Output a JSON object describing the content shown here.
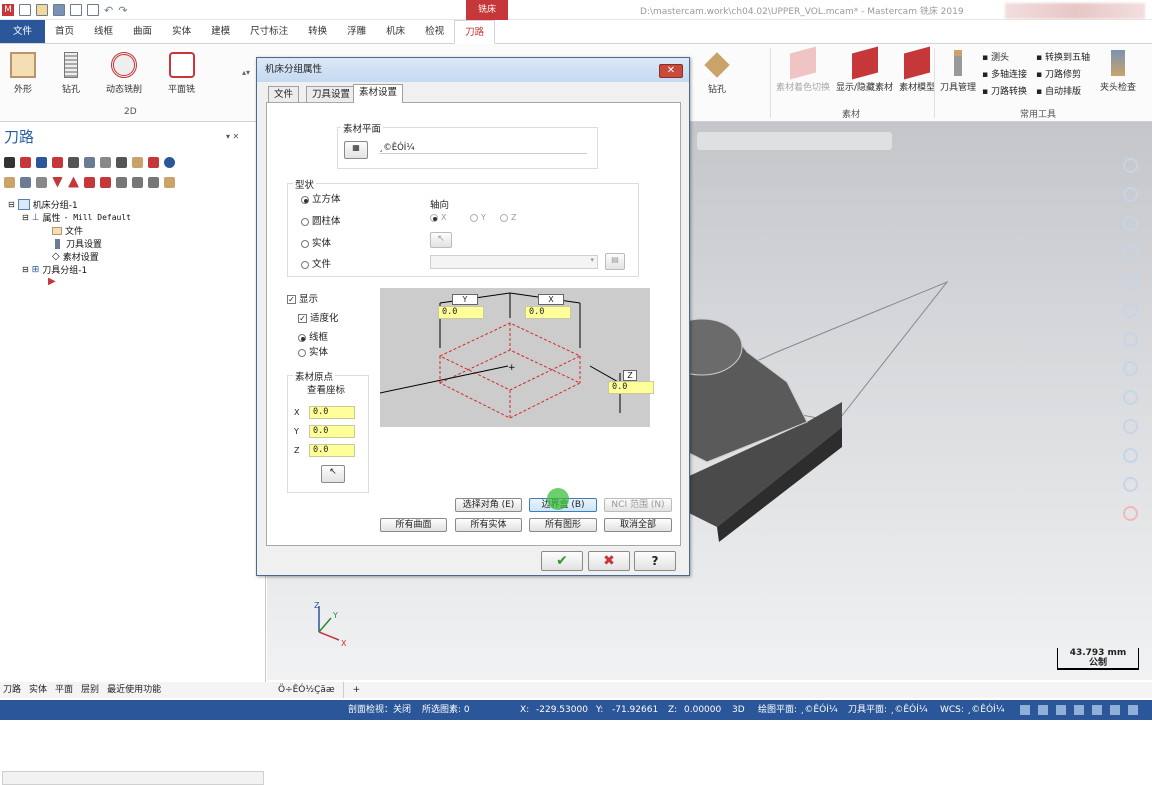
{
  "title_bar": {
    "context_tab": "铣床",
    "file_path": "D:\\mastercam.work\\ch04.02\\UPPER_VOL.mcam* - Mastercam 铣床 2019"
  },
  "menu": {
    "tabs": [
      "文件",
      "首页",
      "线框",
      "曲面",
      "实体",
      "建模",
      "尺寸标注",
      "转换",
      "浮雕",
      "机床",
      "检视",
      "刀路"
    ],
    "active": "刀路"
  },
  "ribbon": {
    "left_buttons": [
      "外形",
      "钻孔",
      "动态铣削",
      "平面铣"
    ],
    "left_group": "2D",
    "drill_button": "钻孔",
    "stock_buttons": [
      "素材着色切换",
      "显示/隐藏素材",
      "素材模型"
    ],
    "stock_group": "素材",
    "tool_manager": "刀具管理",
    "tool_small": [
      "测头",
      "多轴连接",
      "刀路转换",
      "转换到五轴",
      "刀路修剪",
      "自动排版"
    ],
    "clamp_check": "夹头检查",
    "common_group": "常用工具"
  },
  "left_panel": {
    "title": "刀路",
    "tree": [
      {
        "label": "机床分组-1"
      },
      {
        "label": "属性",
        "suffix": "- Mill Default"
      },
      {
        "label": "文件"
      },
      {
        "label": "刀具设置"
      },
      {
        "label": "素材设置"
      },
      {
        "label": "刀具分组-1"
      }
    ],
    "bottom_tabs": [
      "刀路",
      "实体",
      "平面",
      "层别",
      "最近使用功能"
    ]
  },
  "dialog": {
    "title": "机床分组属性",
    "tabs": [
      "文件",
      "刀具设置",
      "素材设置"
    ],
    "active_tab": "素材设置",
    "stock_plane": {
      "label": "素材平面",
      "value": "¸©ÊÓÍ¼"
    },
    "shape": {
      "label": "型状",
      "options": [
        "立方体",
        "圆柱体",
        "实体",
        "文件"
      ],
      "selected": "立方体"
    },
    "axis": {
      "label": "轴向",
      "options": [
        "X",
        "Y",
        "Z"
      ],
      "selected": "X"
    },
    "display": {
      "label": "显示",
      "checked": true
    },
    "fit": {
      "label": "适度化",
      "checked": true
    },
    "display_mode": {
      "options": [
        "线框",
        "实体"
      ],
      "selected": "线框"
    },
    "origin": {
      "label": "素材原点",
      "view_coords": "查看座标",
      "x": "0.0",
      "y": "0.0",
      "z": "0.0"
    },
    "dims": {
      "y_label": "Y",
      "y_value": "0.0",
      "x_label": "X",
      "x_value": "0.0",
      "z_label": "Z",
      "z_value": "0.0"
    },
    "buttons_row1": [
      "选择对角 (E)",
      "边界盒 (B)",
      "NCI 范围 (N)"
    ],
    "buttons_row2": [
      "所有曲面",
      "所有实体",
      "所有图形",
      "取消全部"
    ],
    "ok": "✔",
    "cancel": "✖",
    "help": "?"
  },
  "view": {
    "scale_value": "43.793 mm",
    "scale_unit": "公制",
    "view_tab": "Ö÷ÊÓ½Çãæ"
  },
  "status_bar": {
    "section_view": "剖面检视：关闭",
    "selected": "所选图素: 0",
    "x_label": "X:",
    "x": "-229.53000",
    "y_label": "Y:",
    "y": "-71.92661",
    "z_label": "Z:",
    "z": "0.00000",
    "mode": "3D",
    "cplane": "绘图平面: ¸©ÊÓÍ¼",
    "tplane": "刀具平面: ¸©ÊÓÍ¼",
    "wcs": "WCS: ¸©ÊÓÍ¼"
  },
  "colors": {
    "accent_blue": "#2b579a",
    "context_red": "#c6373a",
    "stock_dash": "#d12a2a",
    "yellow_field": "#ffff99"
  }
}
